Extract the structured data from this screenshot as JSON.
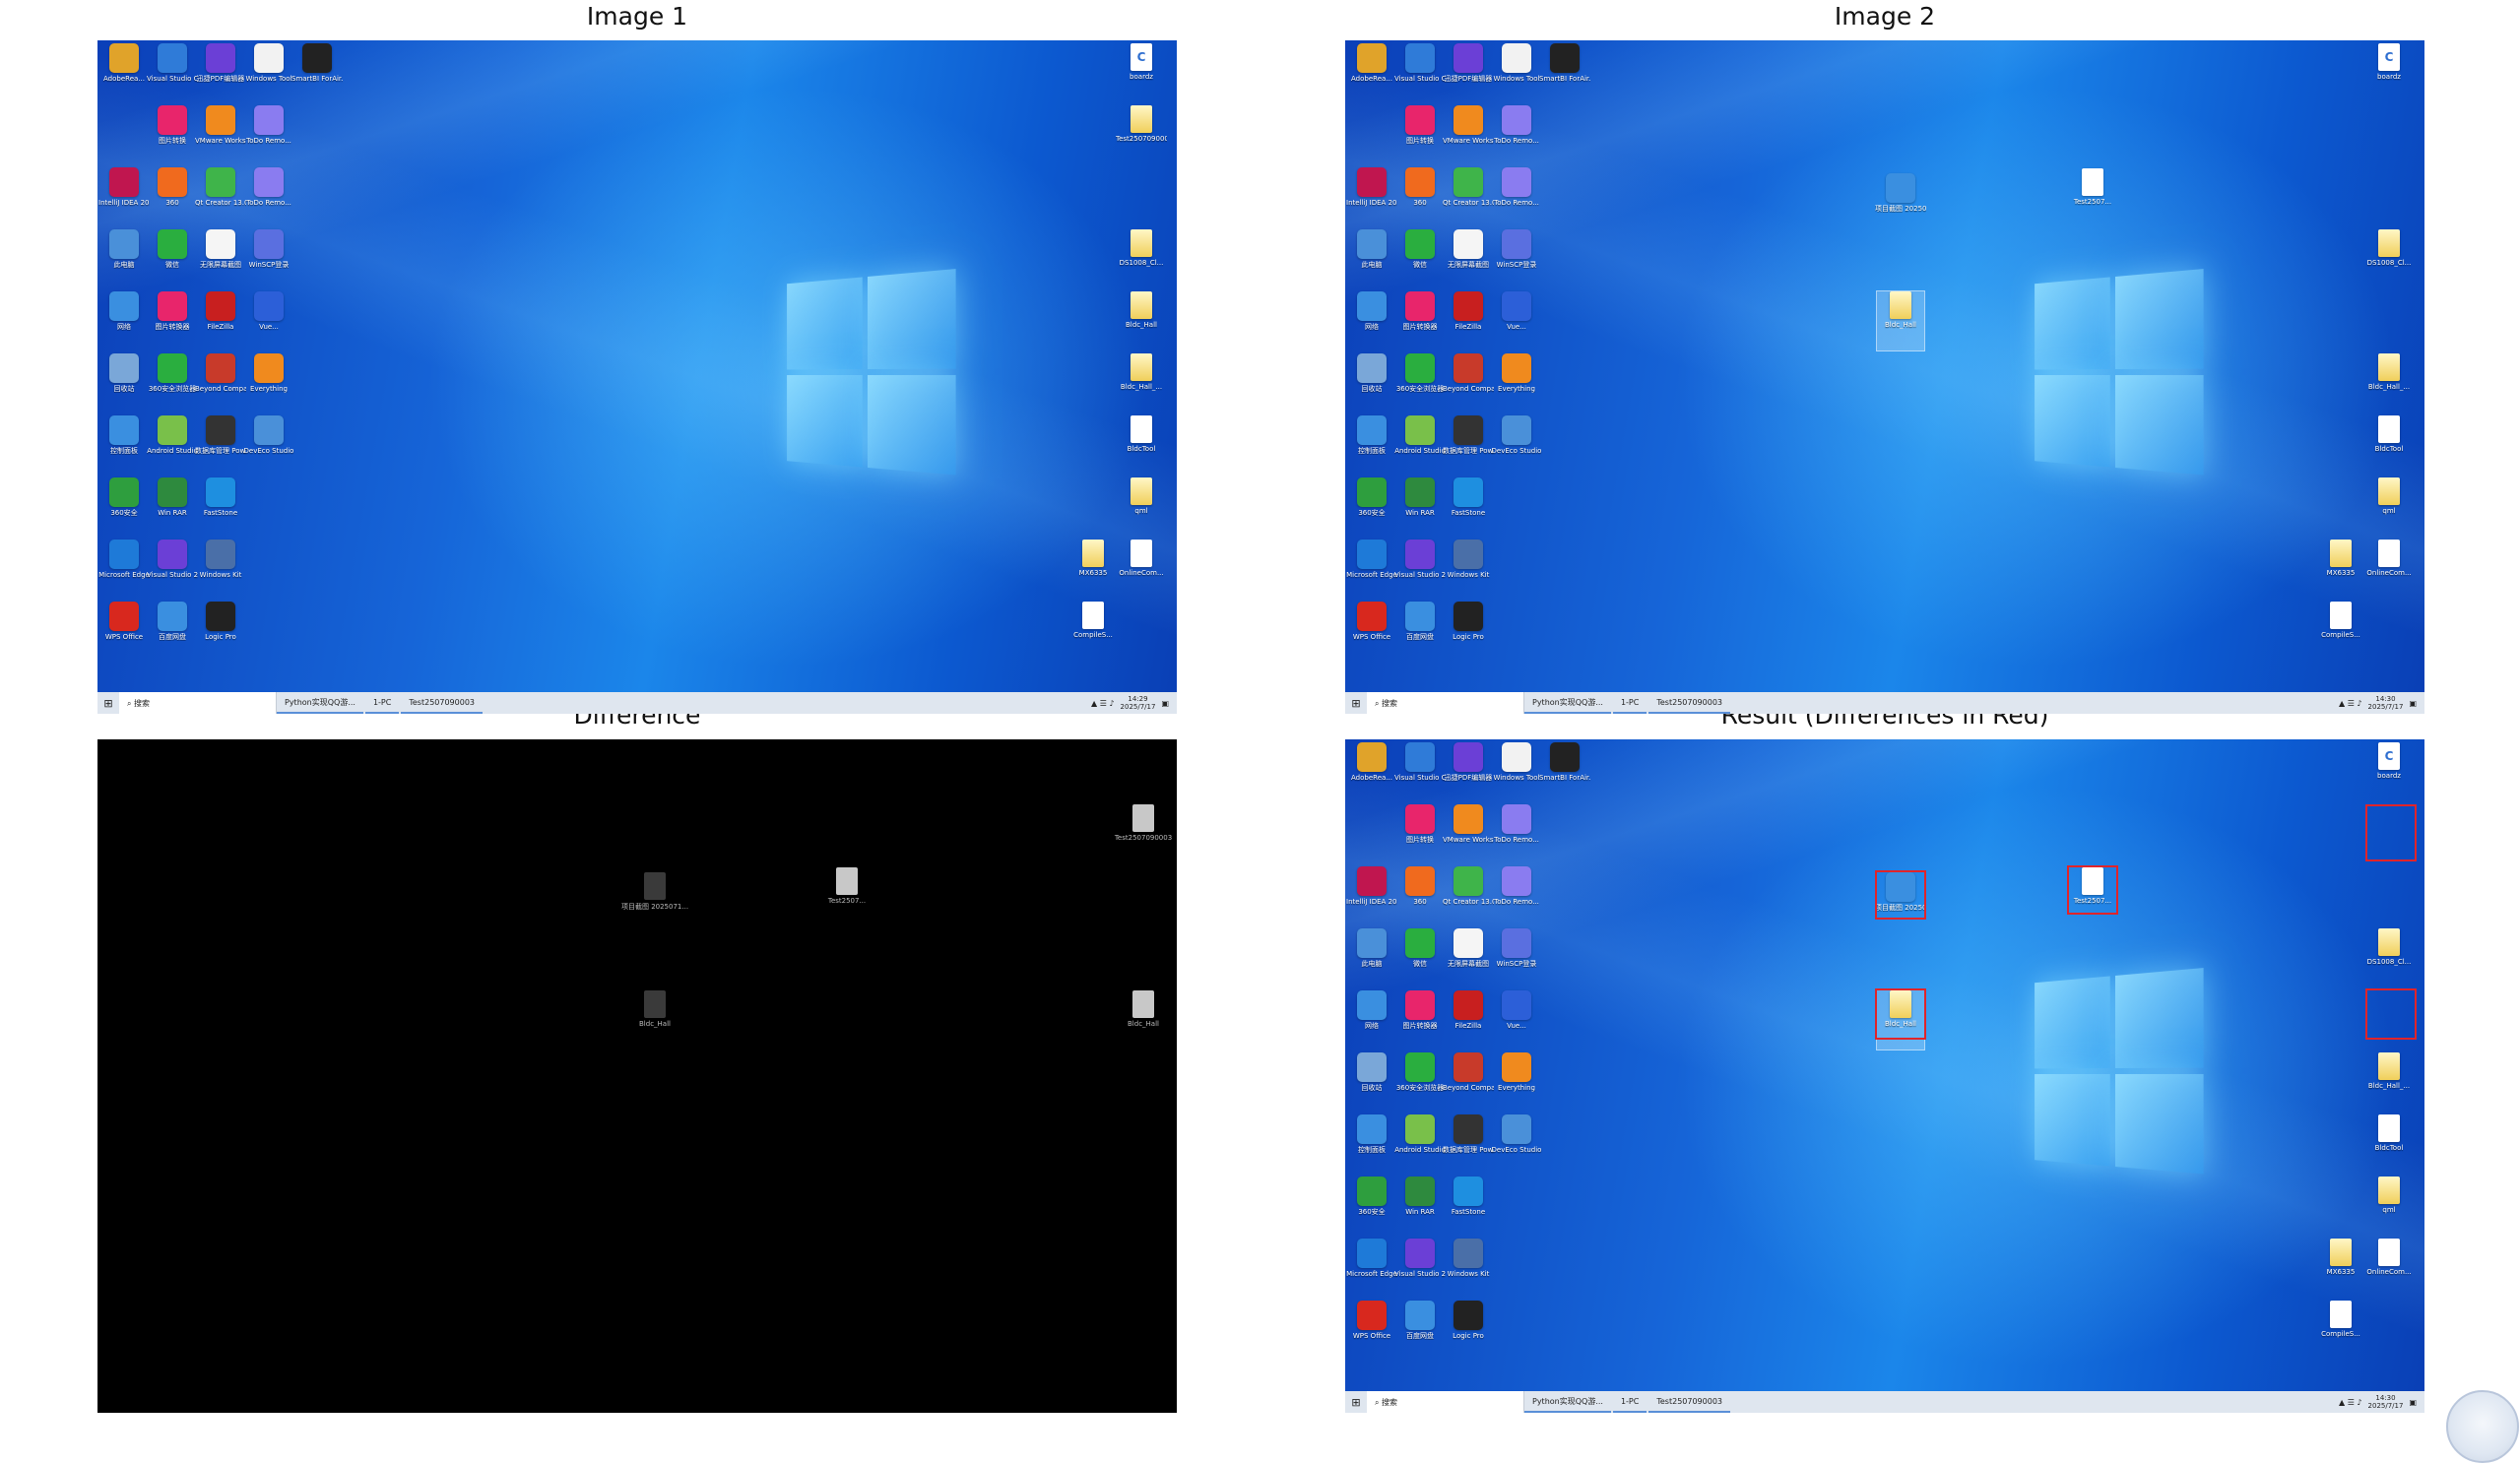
{
  "panels": {
    "p1_title": "Image 1",
    "p2_title": "Image 2",
    "p3_title": "Difference",
    "p4_title": "Result (Differences in Red)"
  },
  "desktop_left_labels": [
    "AdobeRea...",
    "Visual Studio Code",
    "迅捷PDF编辑器",
    "Windows Tool",
    "SmartBI ForAir...",
    "图片转换",
    "VMware Workstat...",
    "ToDo Remo...",
    "IntelliJ IDEA 2023.2",
    "360",
    "Qt Creator 13.0.0",
    "ToDo Remo...",
    "此电脑",
    "微信",
    "无限屏幕截图",
    "WinSCP登录",
    "网络",
    "图片转换器",
    "FileZilla",
    "Vue...",
    "回收站",
    "360安全浏览器",
    "Beyond Compare",
    "Everything",
    "控制面板",
    "Android Studio",
    "数据库管理 Power...",
    "DevEco Studio",
    "360安全",
    "Win RAR",
    "FastStone",
    "Microsoft Edge",
    "Visual Studio 2019",
    "Windows Kit",
    "WPS Office",
    "百度网盘",
    "Logic Pro"
  ],
  "desktop_right_labels": {
    "boardz": "boardz",
    "test_top": "Test2507090003",
    "ds": "DS1008_Cl...",
    "bldc_hall": "Bldc_Hall",
    "bldc_hall2": "Bldc_Hall_...",
    "bldctool": "BldcTool",
    "qml": "qml",
    "mx": "MX6335",
    "online": "OnlineCom...",
    "compile": "CompileS..."
  },
  "image2_extra": {
    "moved_a": "项目截图 2025071...",
    "moved_b": "Test2507...",
    "moved_c": "Bldc_Hall"
  },
  "taskbar": {
    "search": "搜索",
    "item1": "Python实现QQ游...",
    "item2": "1-PC",
    "item3": "Test2507090003",
    "time1": "14:29",
    "time2": "14:30",
    "date": "2025/7/17"
  },
  "diff_labels": {
    "d1": "Test2507090003",
    "d2": "项目截图 2025071...",
    "d3": "Test2507...",
    "d4": "Bldc_Hall",
    "d5": "Bldc_Hall"
  },
  "colors": {
    "highlight": "#e0242a"
  }
}
